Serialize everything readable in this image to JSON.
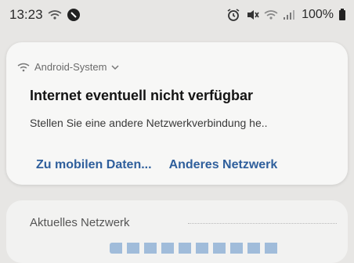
{
  "status_bar": {
    "time": "13:23",
    "battery": "100%",
    "icons": {
      "wifi_left": "wifi-icon",
      "app_left": "app-icon",
      "alarm": "alarm-icon",
      "mute": "mute-icon",
      "wifi_right": "wifi-icon",
      "signal": "signal-icon",
      "battery": "battery-icon"
    }
  },
  "notification": {
    "app_name": "Android-System",
    "title": "Internet eventuell nicht verfügbar",
    "body": "Stellen Sie eine andere Netzwerkverbindung he..",
    "actions": [
      {
        "label": "Zu mobilen Daten..."
      },
      {
        "label": "Anderes Netzwerk"
      }
    ]
  },
  "network_section": {
    "label": "Aktuelles Netzwerk"
  },
  "colors": {
    "background": "#e7e6e4",
    "card": "#f7f7f6",
    "action_text": "#2f5f9c",
    "title_text": "#141414"
  }
}
